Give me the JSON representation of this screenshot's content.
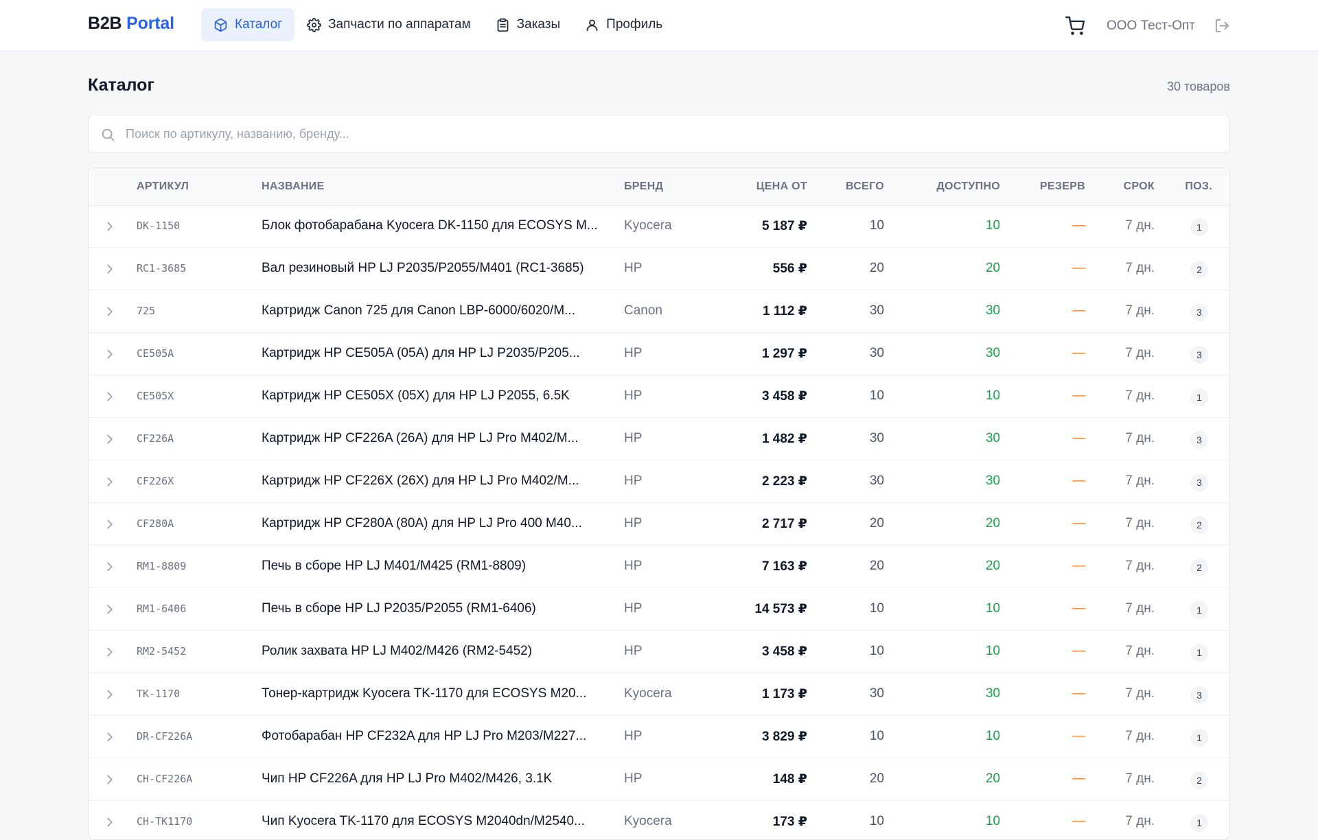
{
  "header": {
    "logo_b2b": "B2B",
    "logo_portal": "Portal",
    "nav": [
      {
        "label": "Каталог",
        "icon": "box-icon",
        "active": true
      },
      {
        "label": "Запчасти по аппаратам",
        "icon": "gear-icon",
        "active": false
      },
      {
        "label": "Заказы",
        "icon": "clipboard-icon",
        "active": false
      },
      {
        "label": "Профиль",
        "icon": "user-icon",
        "active": false
      }
    ],
    "company": "ООО Тест-Опт",
    "cart_icon": "cart-icon",
    "logout_icon": "logout-icon"
  },
  "page": {
    "title": "Каталог",
    "count": "30 товаров"
  },
  "search": {
    "placeholder": "Поиск по артикулу, названию, бренду...",
    "value": ""
  },
  "table": {
    "columns": {
      "sku": "АРТИКУЛ",
      "name": "НАЗВАНИЕ",
      "brand": "БРЕНД",
      "price": "ЦЕНА ОТ",
      "total": "ВСЕГО",
      "available": "ДОСТУПНО",
      "reserve": "РЕЗЕРВ",
      "term": "СРОК",
      "positions": "ПОЗ."
    },
    "rows": [
      {
        "sku": "DK-1150",
        "name": "Блок фотобарабана Kyocera DK-1150 для ECOSYS M...",
        "brand": "Kyocera",
        "price": "5 187 ₽",
        "total": "10",
        "available": "10",
        "reserve": "—",
        "term": "7 дн.",
        "positions": "1"
      },
      {
        "sku": "RC1-3685",
        "name": "Вал резиновый HP LJ P2035/P2055/M401 (RC1-3685)",
        "brand": "HP",
        "price": "556 ₽",
        "total": "20",
        "available": "20",
        "reserve": "—",
        "term": "7 дн.",
        "positions": "2"
      },
      {
        "sku": "725",
        "name": "Картридж Canon 725 для Canon LBP-6000/6020/M...",
        "brand": "Canon",
        "price": "1 112 ₽",
        "total": "30",
        "available": "30",
        "reserve": "—",
        "term": "7 дн.",
        "positions": "3"
      },
      {
        "sku": "CE505A",
        "name": "Картридж HP CE505A (05A) для HP LJ P2035/P205...",
        "brand": "HP",
        "price": "1 297 ₽",
        "total": "30",
        "available": "30",
        "reserve": "—",
        "term": "7 дн.",
        "positions": "3"
      },
      {
        "sku": "CE505X",
        "name": "Картридж HP CE505X (05X) для HP LJ P2055, 6.5K",
        "brand": "HP",
        "price": "3 458 ₽",
        "total": "10",
        "available": "10",
        "reserve": "—",
        "term": "7 дн.",
        "positions": "1"
      },
      {
        "sku": "CF226A",
        "name": "Картридж HP CF226A (26A) для HP LJ Pro M402/M...",
        "brand": "HP",
        "price": "1 482 ₽",
        "total": "30",
        "available": "30",
        "reserve": "—",
        "term": "7 дн.",
        "positions": "3"
      },
      {
        "sku": "CF226X",
        "name": "Картридж HP CF226X (26X) для HP LJ Pro M402/M...",
        "brand": "HP",
        "price": "2 223 ₽",
        "total": "30",
        "available": "30",
        "reserve": "—",
        "term": "7 дн.",
        "positions": "3"
      },
      {
        "sku": "CF280A",
        "name": "Картридж HP CF280A (80A) для HP LJ Pro 400 M40...",
        "brand": "HP",
        "price": "2 717 ₽",
        "total": "20",
        "available": "20",
        "reserve": "—",
        "term": "7 дн.",
        "positions": "2"
      },
      {
        "sku": "RM1-8809",
        "name": "Печь в сборе HP LJ M401/M425 (RM1-8809)",
        "brand": "HP",
        "price": "7 163 ₽",
        "total": "20",
        "available": "20",
        "reserve": "—",
        "term": "7 дн.",
        "positions": "2"
      },
      {
        "sku": "RM1-6406",
        "name": "Печь в сборе HP LJ P2035/P2055 (RM1-6406)",
        "brand": "HP",
        "price": "14 573 ₽",
        "total": "10",
        "available": "10",
        "reserve": "—",
        "term": "7 дн.",
        "positions": "1"
      },
      {
        "sku": "RM2-5452",
        "name": "Ролик захвата HP LJ M402/M426 (RM2-5452)",
        "brand": "HP",
        "price": "3 458 ₽",
        "total": "10",
        "available": "10",
        "reserve": "—",
        "term": "7 дн.",
        "positions": "1"
      },
      {
        "sku": "TK-1170",
        "name": "Тонер-картридж Kyocera TK-1170 для ECOSYS M20...",
        "brand": "Kyocera",
        "price": "1 173 ₽",
        "total": "30",
        "available": "30",
        "reserve": "—",
        "term": "7 дн.",
        "positions": "3"
      },
      {
        "sku": "DR-CF226A",
        "name": "Фотобарабан HP CF232A для HP LJ Pro M203/M227...",
        "brand": "HP",
        "price": "3 829 ₽",
        "total": "10",
        "available": "10",
        "reserve": "—",
        "term": "7 дн.",
        "positions": "1"
      },
      {
        "sku": "CH-CF226A",
        "name": "Чип HP CF226A для HP LJ Pro M402/M426, 3.1K",
        "brand": "HP",
        "price": "148 ₽",
        "total": "20",
        "available": "20",
        "reserve": "—",
        "term": "7 дн.",
        "positions": "2"
      },
      {
        "sku": "CH-TK1170",
        "name": "Чип Kyocera TK-1170 для ECOSYS M2040dn/M2540...",
        "brand": "Kyocera",
        "price": "173 ₽",
        "total": "10",
        "available": "10",
        "reserve": "—",
        "term": "7 дн.",
        "positions": "1"
      }
    ]
  },
  "colors": {
    "accent": "#2563eb",
    "available": "#16a34a",
    "reserve": "#f97316"
  }
}
